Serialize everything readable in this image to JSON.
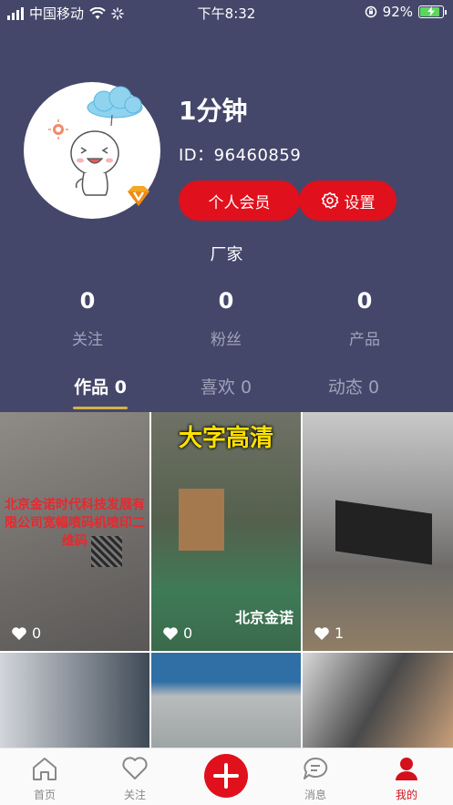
{
  "status_bar": {
    "carrier": "中国移动",
    "time": "下午8:32",
    "battery": "92%",
    "battery_level": 0.92
  },
  "profile": {
    "username": "1分钟",
    "user_id": "ID：96460859",
    "member_button": "个人会员",
    "settings_button": "设置",
    "role": "厂家"
  },
  "stats": [
    {
      "value": "0",
      "label": "关注"
    },
    {
      "value": "0",
      "label": "粉丝"
    },
    {
      "value": "0",
      "label": "产品"
    }
  ],
  "tabs": [
    {
      "label": "作品 0"
    },
    {
      "label": "喜欢 0"
    },
    {
      "label": "动态 0"
    }
  ],
  "posts": [
    {
      "likes": "0",
      "overlay_text": "北京金诺时代科技发展有限公司宽幅喷码机喷印二维码",
      "caption": ""
    },
    {
      "likes": "0",
      "overlay_text": "大字高清",
      "caption": "北京金诺"
    },
    {
      "likes": "1",
      "overlay_text": "",
      "caption": ""
    }
  ],
  "bottom_nav": {
    "home": "首页",
    "follow": "关注",
    "messages": "消息",
    "mine": "我的"
  },
  "colors": {
    "header_bg": "#44476a",
    "accent_red": "#e0101c",
    "tab_underline": "#d4b04a"
  }
}
